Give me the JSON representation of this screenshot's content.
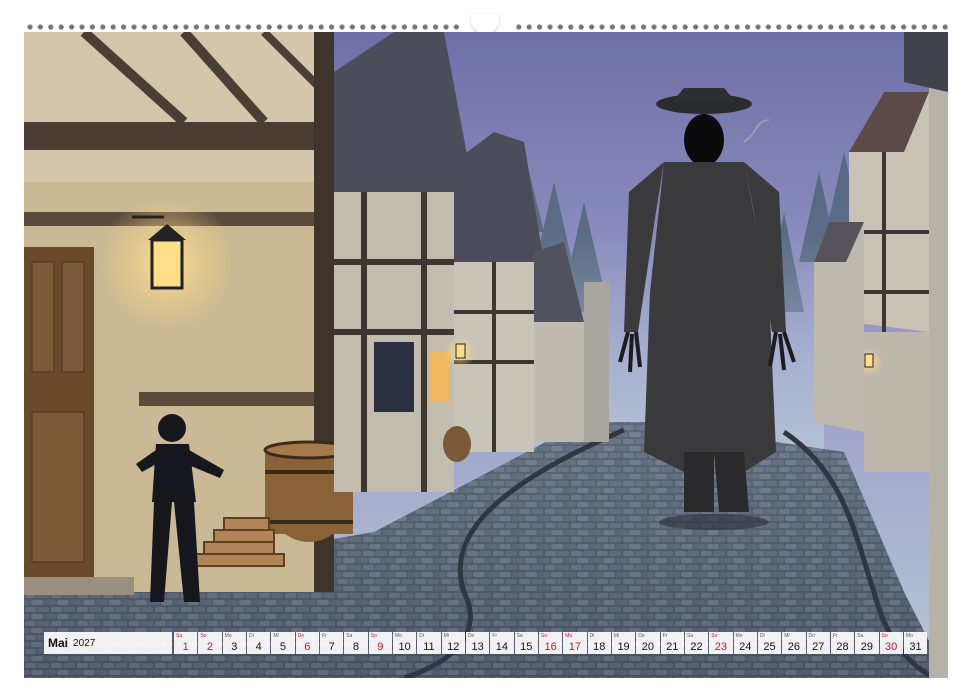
{
  "calendar": {
    "month": "Mai",
    "year": "2027",
    "days": [
      {
        "dow": "Sa",
        "num": "1",
        "red": true
      },
      {
        "dow": "So",
        "num": "2",
        "red": true
      },
      {
        "dow": "Mo",
        "num": "3",
        "red": false
      },
      {
        "dow": "Di",
        "num": "4",
        "red": false
      },
      {
        "dow": "Mi",
        "num": "5",
        "red": false
      },
      {
        "dow": "Do",
        "num": "6",
        "red": true
      },
      {
        "dow": "Fr",
        "num": "7",
        "red": false
      },
      {
        "dow": "Sa",
        "num": "8",
        "red": false
      },
      {
        "dow": "So",
        "num": "9",
        "red": true
      },
      {
        "dow": "Mo",
        "num": "10",
        "red": false
      },
      {
        "dow": "Di",
        "num": "11",
        "red": false
      },
      {
        "dow": "Mi",
        "num": "12",
        "red": false
      },
      {
        "dow": "Do",
        "num": "13",
        "red": false
      },
      {
        "dow": "Fr",
        "num": "14",
        "red": false
      },
      {
        "dow": "Sa",
        "num": "15",
        "red": false
      },
      {
        "dow": "So",
        "num": "16",
        "red": true
      },
      {
        "dow": "Mo",
        "num": "17",
        "red": true
      },
      {
        "dow": "Di",
        "num": "18",
        "red": false
      },
      {
        "dow": "Mi",
        "num": "19",
        "red": false
      },
      {
        "dow": "Do",
        "num": "20",
        "red": false
      },
      {
        "dow": "Fr",
        "num": "21",
        "red": false
      },
      {
        "dow": "Sa",
        "num": "22",
        "red": false
      },
      {
        "dow": "So",
        "num": "23",
        "red": true
      },
      {
        "dow": "Mo",
        "num": "24",
        "red": false
      },
      {
        "dow": "Di",
        "num": "25",
        "red": false
      },
      {
        "dow": "Mi",
        "num": "26",
        "red": false
      },
      {
        "dow": "Do",
        "num": "27",
        "red": false
      },
      {
        "dow": "Fr",
        "num": "28",
        "red": false
      },
      {
        "dow": "Sa",
        "num": "29",
        "red": false
      },
      {
        "dow": "So",
        "num": "30",
        "red": true
      },
      {
        "dow": "Mo",
        "num": "31",
        "red": false
      }
    ]
  },
  "colors": {
    "sky": "#8c8cc0",
    "fog": "#9fb0c6",
    "cobble": "#5a6474",
    "wall": "#d9cdb5",
    "timber": "#4a3d33",
    "lamp": "#ffcf6a",
    "holiday": "#c8102e"
  }
}
